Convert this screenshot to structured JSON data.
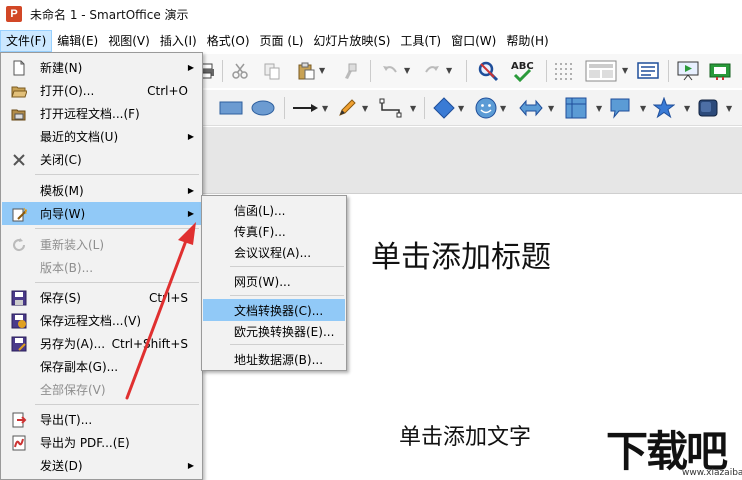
{
  "window": {
    "app_icon_letter": "P",
    "title": "未命名 1 - SmartOffice 演示"
  },
  "menubar": {
    "items": [
      {
        "label": "文件(F)"
      },
      {
        "label": "编辑(E)"
      },
      {
        "label": "视图(V)"
      },
      {
        "label": "插入(I)"
      },
      {
        "label": "格式(O)"
      },
      {
        "label": "页面 (L)"
      },
      {
        "label": "幻灯片放映(S)"
      },
      {
        "label": "工具(T)"
      },
      {
        "label": "窗口(W)"
      },
      {
        "label": "帮助(H)"
      }
    ]
  },
  "file_menu": {
    "items": [
      {
        "label": "新建(N)",
        "shortcut": "",
        "submenu": true,
        "disabled": false,
        "icon": "new-document-icon"
      },
      {
        "label": "打开(O)...",
        "shortcut": "Ctrl+O",
        "submenu": false,
        "disabled": false,
        "icon": "open-folder-icon"
      },
      {
        "label": "打开远程文档...(F)",
        "shortcut": "",
        "submenu": false,
        "disabled": false,
        "icon": "remote-open-icon"
      },
      {
        "label": "最近的文档(U)",
        "shortcut": "",
        "submenu": true,
        "disabled": false,
        "icon": ""
      },
      {
        "label": "关闭(C)",
        "shortcut": "",
        "submenu": false,
        "disabled": false,
        "icon": "close-icon"
      },
      {
        "label": "模板(M)",
        "shortcut": "",
        "submenu": true,
        "disabled": false,
        "icon": ""
      },
      {
        "label": "向导(W)",
        "shortcut": "",
        "submenu": true,
        "disabled": false,
        "icon": "wizard-icon",
        "highlighted": true
      },
      {
        "label": "重新装入(L)",
        "shortcut": "",
        "submenu": false,
        "disabled": true,
        "icon": "reload-icon"
      },
      {
        "label": "版本(B)...",
        "shortcut": "",
        "submenu": false,
        "disabled": true,
        "icon": ""
      },
      {
        "label": "保存(S)",
        "shortcut": "Ctrl+S",
        "submenu": false,
        "disabled": false,
        "icon": "save-icon"
      },
      {
        "label": "保存远程文档...(V)",
        "shortcut": "",
        "submenu": false,
        "disabled": false,
        "icon": "save-remote-icon"
      },
      {
        "label": "另存为(A)...",
        "shortcut": "Ctrl+Shift+S",
        "submenu": false,
        "disabled": false,
        "icon": "save-as-icon"
      },
      {
        "label": "保存副本(G)...",
        "shortcut": "",
        "submenu": false,
        "disabled": false,
        "icon": ""
      },
      {
        "label": "全部保存(V)",
        "shortcut": "",
        "submenu": false,
        "disabled": true,
        "icon": ""
      },
      {
        "label": "导出(T)...",
        "shortcut": "",
        "submenu": false,
        "disabled": false,
        "icon": "export-icon"
      },
      {
        "label": "导出为 PDF...(E)",
        "shortcut": "",
        "submenu": false,
        "disabled": false,
        "icon": "pdf-icon"
      },
      {
        "label": "发送(D)",
        "shortcut": "",
        "submenu": true,
        "disabled": false,
        "icon": ""
      }
    ]
  },
  "wizard_submenu": {
    "items": [
      {
        "label": "信函(L)..."
      },
      {
        "label": "传真(F)..."
      },
      {
        "label": "会议议程(A)..."
      },
      {
        "label": "网页(W)..."
      },
      {
        "label": "文档转换器(C)...",
        "highlighted": true
      },
      {
        "label": "欧元换转换器(E)..."
      },
      {
        "label": "地址数据源(B)..."
      }
    ]
  },
  "slide": {
    "title_placeholder": "单击添加标题",
    "text_placeholder": "单击添加文字"
  },
  "watermark": {
    "logo_text": "下载吧",
    "url": "www.xiazaiba.com"
  },
  "colors": {
    "highlight": "#91c9f7",
    "menu_bg": "#f2f2f2",
    "arrow": "#e03030",
    "app_icon": "#d24726"
  }
}
